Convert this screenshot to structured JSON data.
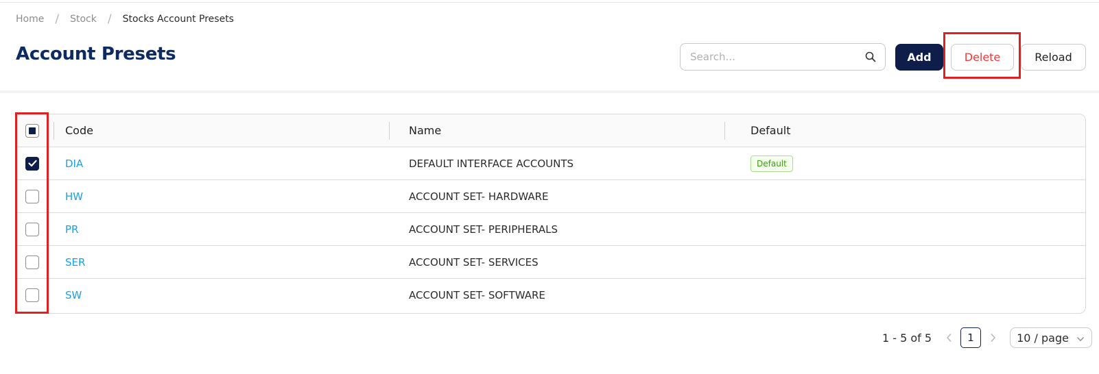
{
  "breadcrumb": {
    "items": [
      "Home",
      "Stock",
      "Stocks Account Presets"
    ],
    "separator": "/"
  },
  "page_title": "Account Presets",
  "search": {
    "placeholder": "Search...",
    "value": "",
    "icon": "search-icon"
  },
  "toolbar": {
    "add_label": "Add",
    "delete_label": "Delete",
    "reload_label": "Reload"
  },
  "table": {
    "columns": [
      "Code",
      "Name",
      "Default"
    ],
    "header_checkbox_state": "indeterminate",
    "rows": [
      {
        "code": "DIA",
        "name": "DEFAULT INTERFACE ACCOUNTS",
        "default_tag": "Default",
        "checked": true
      },
      {
        "code": "HW",
        "name": "ACCOUNT SET- HARDWARE",
        "default_tag": "",
        "checked": false
      },
      {
        "code": "PR",
        "name": "ACCOUNT SET- PERIPHERALS",
        "default_tag": "",
        "checked": false
      },
      {
        "code": "SER",
        "name": "ACCOUNT SET- SERVICES",
        "default_tag": "",
        "checked": false
      },
      {
        "code": "SW",
        "name": "ACCOUNT SET- SOFTWARE",
        "default_tag": "",
        "checked": false
      }
    ]
  },
  "pagination": {
    "range_text": "1 - 5 of 5",
    "current_page": "1",
    "page_size": "10 / page"
  },
  "colors": {
    "title": "#0d2a63",
    "primary": "#0e1d4a",
    "link": "#1ba1e2",
    "danger": "#ef3a3a",
    "highlight": "#e0201f",
    "tag_green": "#389e0d"
  }
}
